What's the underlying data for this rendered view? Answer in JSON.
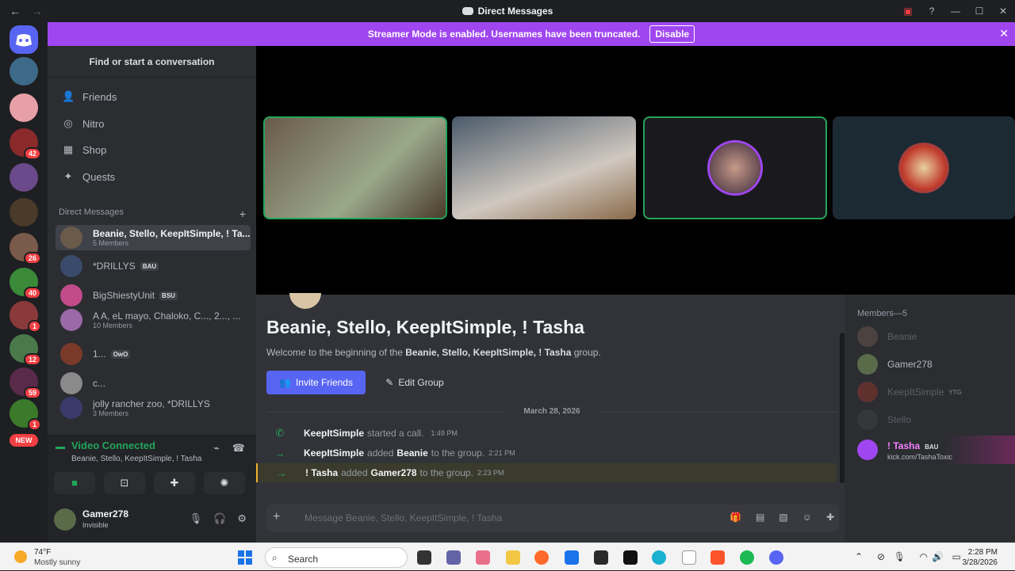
{
  "window": {
    "title": "Direct Messages",
    "nav_back": "←",
    "nav_fwd": "→"
  },
  "guilds": {
    "badges": [
      "42",
      "26",
      "40",
      "1",
      "12",
      "59",
      "1"
    ],
    "new_label": "NEW"
  },
  "banner": {
    "text": "Streamer Mode is enabled. Usernames have been truncated.",
    "button": "Disable"
  },
  "sidebar": {
    "find": "Find or start a conversation",
    "nav": [
      {
        "label": "Friends",
        "icon": "friends-icon"
      },
      {
        "label": "Nitro",
        "icon": "nitro-icon"
      },
      {
        "label": "Shop",
        "icon": "shop-icon"
      },
      {
        "label": "Quests",
        "icon": "quests-icon"
      }
    ],
    "dm_header": "Direct Messages",
    "dms": [
      {
        "name": "Beanie, Stello, KeepItSimple, ! Ta...",
        "sub": "5 Members",
        "tag": ""
      },
      {
        "name": "*DRILLYS",
        "sub": "",
        "tag": "BAU"
      },
      {
        "name": "BigShiestyUnit",
        "sub": "",
        "tag": "BSU"
      },
      {
        "name": "A A, eL mayo, Chaloko, C..., 2..., ...",
        "sub": "10 Members",
        "tag": ""
      },
      {
        "name": "1...",
        "sub": "",
        "tag": "OwO"
      },
      {
        "name": "c...",
        "sub": "",
        "tag": ""
      },
      {
        "name": "jolly rancher zoo, *DRILLYS",
        "sub": "3 Members",
        "tag": ""
      }
    ]
  },
  "voice": {
    "status": "Video Connected",
    "channel": "Beanie, Stello, KeepItSimple, ! Tasha"
  },
  "user": {
    "name": "Gamer278",
    "status": "Invisible"
  },
  "chat": {
    "title": "Beanie, Stello, KeepItSimple, ! Tasha",
    "welcome_pre": "Welcome to the beginning of the",
    "welcome_group": "Beanie, Stello, KeepItSimple, ! Tasha",
    "welcome_post": "group.",
    "invite": "Invite Friends",
    "edit": "Edit Group",
    "date": "March 28, 2026",
    "messages": [
      {
        "actor": "KeepItSimple",
        "action": "started a call.",
        "target": "",
        "after": "",
        "time": "1:49 PM"
      },
      {
        "actor": "KeepItSimple",
        "action": "added",
        "target": "Beanie",
        "after": "to the group.",
        "time": "2:21 PM"
      },
      {
        "actor": "! Tasha",
        "action": "added",
        "target": "Gamer278",
        "after": "to the group.",
        "time": "2:23 PM"
      }
    ],
    "placeholder": "Message Beanie, Stello, KeepItSimple, ! Tasha"
  },
  "members": {
    "header": "Members—5",
    "list": [
      {
        "name": "Beanie",
        "tag": "",
        "sub": ""
      },
      {
        "name": "Gamer278",
        "tag": "",
        "sub": ""
      },
      {
        "name": "KeepItSimple",
        "tag": "YTG",
        "sub": ""
      },
      {
        "name": "Stello",
        "tag": "",
        "sub": ""
      },
      {
        "name": "! Tasha",
        "tag": "BAU",
        "sub": "kick.com/TashaToxic"
      }
    ]
  },
  "taskbar": {
    "temp": "74°F",
    "weather": "Mostly sunny",
    "search": "Search",
    "time": "2:28 PM",
    "date": "3/28/2026"
  },
  "colors": {
    "accent": "#5865f2",
    "banner": "#a046f0",
    "online": "#23a55a"
  }
}
